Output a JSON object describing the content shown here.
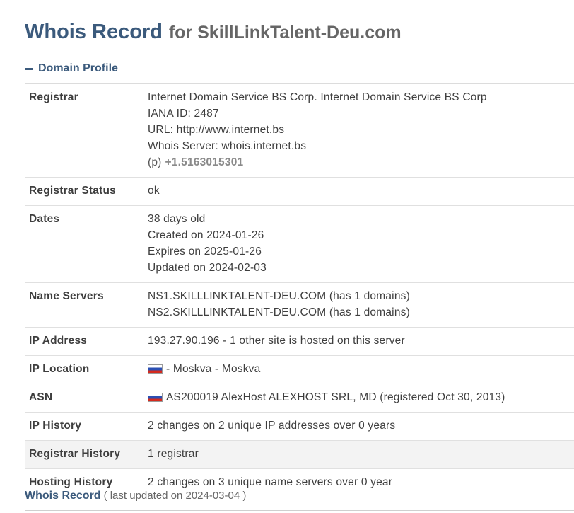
{
  "header": {
    "title": "Whois Record",
    "for_text": "for SkillLinkTalent-Deu.com"
  },
  "section": {
    "label": "Domain Profile"
  },
  "registrar": {
    "label": "Registrar",
    "name": "Internet Domain Service BS Corp. Internet Domain Service BS Corp",
    "iana": "IANA ID: 2487",
    "url": "URL: http://www.internet.bs",
    "whois_server": "Whois Server: whois.internet.bs",
    "phone_label": "(p)",
    "phone": "+1.5163015301"
  },
  "registrar_status": {
    "label": "Registrar Status",
    "value": "ok"
  },
  "dates": {
    "label": "Dates",
    "age": "38 days old",
    "created": "Created on 2024-01-26",
    "expires": "Expires on 2025-01-26",
    "updated": "Updated on 2024-02-03"
  },
  "name_servers": {
    "label": "Name Servers",
    "ns1": "NS1.SKILLLINKTALENT-DEU.COM (has 1 domains)",
    "ns2": "NS2.SKILLLINKTALENT-DEU.COM (has 1 domains)"
  },
  "ip_address": {
    "label": "IP Address",
    "value": "193.27.90.196 - 1 other site is hosted on this server"
  },
  "ip_location": {
    "label": "IP Location",
    "value": "- Moskva - Moskva",
    "flag": "russia-flag-icon"
  },
  "asn": {
    "label": "ASN",
    "value": "AS200019 AlexHost ALEXHOST SRL, MD (registered Oct 30, 2013)",
    "flag": "russia-flag-icon"
  },
  "ip_history": {
    "label": "IP History",
    "value": "2 changes on 2 unique IP addresses over 0 years"
  },
  "registrar_history": {
    "label": "Registrar History",
    "value": "1 registrar"
  },
  "hosting_history": {
    "label": "Hosting History",
    "value": "2 changes on 3 unique name servers over 0 year"
  },
  "footer": {
    "title": "Whois Record",
    "updated": "( last updated on 2024-03-04 )"
  },
  "colors": {
    "heading_blue": "#3b5a7c",
    "shaded_row": "#f3f3f3"
  }
}
